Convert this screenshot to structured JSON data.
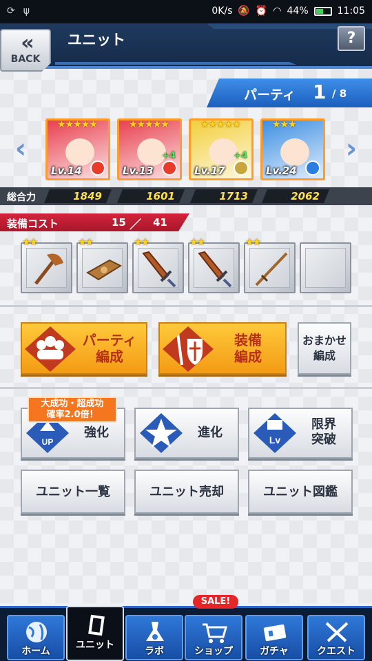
{
  "status": {
    "speed": "0K/s",
    "battery": "44%",
    "time": "11:05"
  },
  "header": {
    "back_label": "BACK",
    "title": "ユニット",
    "help": "?"
  },
  "party": {
    "label": "パーティ",
    "current": "1",
    "total": "/ 8"
  },
  "units": [
    {
      "stars": "★★★★★",
      "level": "Lv.14",
      "plus": "",
      "element_color": "#e83b2a",
      "bg": "#e8414f"
    },
    {
      "stars": "★★★★★",
      "level": "Lv.13",
      "plus": "+4",
      "element_color": "#e83b2a",
      "bg": "#e8414f"
    },
    {
      "stars": "★★★★★",
      "level": "Lv.17",
      "plus": "+4",
      "element_color": "#c9a63b",
      "bg": "#f2cf3c"
    },
    {
      "stars": "★★★",
      "level": "Lv.24",
      "plus": "",
      "element_color": "#2a7ee0",
      "bg": "#3d8fe3"
    }
  ],
  "power": {
    "label": "総合力",
    "values": [
      "1849",
      "1601",
      "1713",
      "2062"
    ]
  },
  "equip_cost": {
    "label": "装備コスト",
    "used": "15",
    "slash": "／",
    "max": "41"
  },
  "equipment": [
    {
      "stars": "★★",
      "icon": "axe-icon"
    },
    {
      "stars": "★★",
      "icon": "book-icon"
    },
    {
      "stars": "★★",
      "icon": "sword-icon"
    },
    {
      "stars": "★★",
      "icon": "sword-icon"
    },
    {
      "stars": "★★",
      "icon": "spear-icon"
    },
    {
      "stars": "",
      "icon": "empty-slot"
    }
  ],
  "buttons": {
    "party_edit": "パーティ\n編成",
    "equip_edit": "装備\n編成",
    "auto_edit": "おまかせ\n編成",
    "promo": "大成功・超成功\n確率2.0倍！",
    "enhance": "強化",
    "evolve": "進化",
    "limit_break": "限界\n突破",
    "unit_list": "ユニット一覧",
    "unit_sell": "ユニット売却",
    "unit_book": "ユニット図鑑"
  },
  "nav": {
    "home": "ホーム",
    "unit": "ユニット",
    "lab": "ラボ",
    "shop": "ショップ",
    "sale": "SALE!",
    "gacha": "ガチャ",
    "quest": "クエスト"
  }
}
